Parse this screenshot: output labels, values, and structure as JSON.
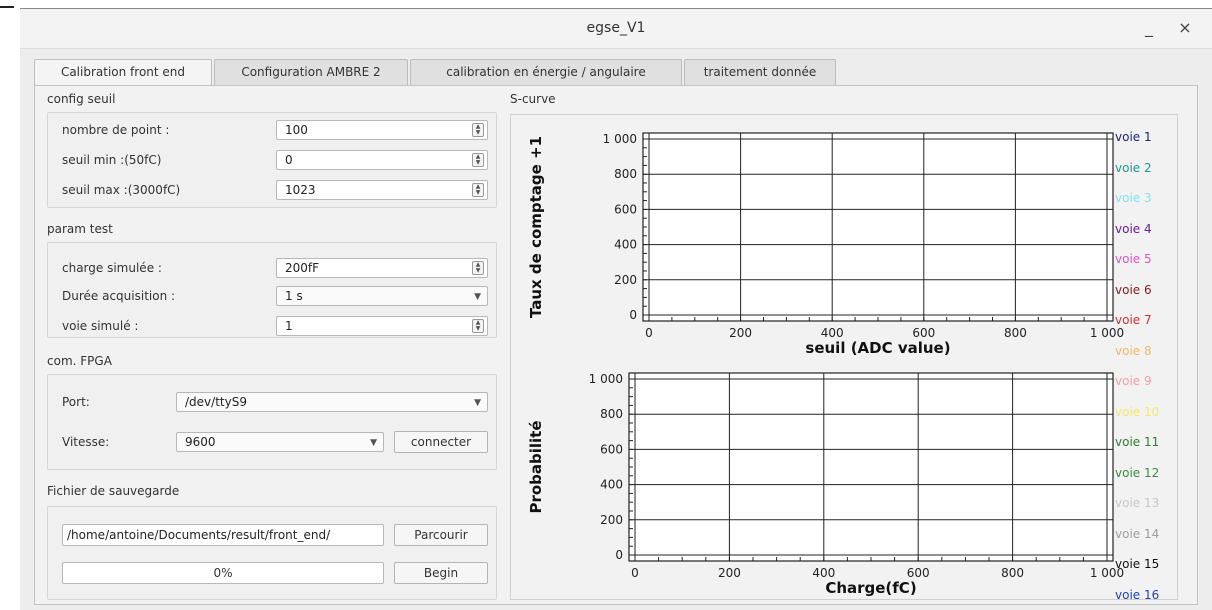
{
  "window": {
    "title": "egse_V1",
    "minimize": "_",
    "close": "×"
  },
  "tabs": [
    {
      "label": "Calibration front end",
      "active": true
    },
    {
      "label": "Configuration AMBRE 2",
      "active": false
    },
    {
      "label": "calibration en énergie / angulaire",
      "active": false
    },
    {
      "label": "traitement donnée",
      "active": false
    }
  ],
  "config_seuil": {
    "title": "config seuil",
    "nombre_label": "nombre de point :",
    "nombre_value": "100",
    "seuil_min_label": "seuil min :(50fC)",
    "seuil_min_value": "0",
    "seuil_max_label": "seuil max :(3000fC)",
    "seuil_max_value": "1023"
  },
  "param_test": {
    "title": "param test",
    "charge_label": "charge simulée :",
    "charge_value": "200fF",
    "duree_label": "Durée acquisition :",
    "duree_value": "1 s",
    "voie_label": "voie simulé :",
    "voie_value": "1"
  },
  "com_fpga": {
    "title": "com. FPGA",
    "port_label": "Port:",
    "port_value": "/dev/ttyS9",
    "vitesse_label": "Vitesse:",
    "vitesse_value": "9600",
    "connect_label": "connecter"
  },
  "fichier": {
    "title": "Fichier de sauvegarde",
    "path_value": "/home/antoine/Documents/result/front_end/",
    "browse_label": "Parcourir",
    "progress_text": "0%",
    "progress": 0,
    "begin_label": "Begin"
  },
  "plot_title": "S-curve",
  "legend": [
    {
      "label": "voie 1",
      "color": "#1a237e"
    },
    {
      "label": "voie 2",
      "color": "#1a9a8a"
    },
    {
      "label": "voie 3",
      "color": "#7fe3ee"
    },
    {
      "label": "voie 4",
      "color": "#6a1b9a"
    },
    {
      "label": "voie 5",
      "color": "#e050d0"
    },
    {
      "label": "voie 6",
      "color": "#8b1a1a"
    },
    {
      "label": "voie 7",
      "color": "#d32f2f"
    },
    {
      "label": "voie 8",
      "color": "#f0b860"
    },
    {
      "label": "voie 9",
      "color": "#f2a0a0"
    },
    {
      "label": "voie 10",
      "color": "#f8e860"
    },
    {
      "label": "voie 11",
      "color": "#2e7d32"
    },
    {
      "label": "voie 12",
      "color": "#388e3c"
    },
    {
      "label": "voie 13",
      "color": "#c8c8c8"
    },
    {
      "label": "voie 14",
      "color": "#9e9e9e"
    },
    {
      "label": "voie 15",
      "color": "#111111"
    },
    {
      "label": "voie 16",
      "color": "#1e3fbf"
    }
  ],
  "chart_data": [
    {
      "type": "line",
      "xlabel": "seuil (ADC value)",
      "ylabel": "Taux de comptage +1",
      "xlim": [
        0,
        1000
      ],
      "ylim": [
        0,
        1000
      ],
      "x_ticks": [
        "0",
        "200",
        "400",
        "600",
        "800",
        "1 000"
      ],
      "y_ticks": [
        "0",
        "200",
        "400",
        "600",
        "800",
        "1 000"
      ],
      "grid": true,
      "series": []
    },
    {
      "type": "line",
      "xlabel": "Charge(fC)",
      "ylabel": "Probabilité",
      "xlim": [
        0,
        1000
      ],
      "ylim": [
        0,
        1000
      ],
      "x_ticks": [
        "0",
        "200",
        "400",
        "600",
        "800",
        "1 000"
      ],
      "y_ticks": [
        "0",
        "200",
        "400",
        "600",
        "800",
        "1 000"
      ],
      "grid": true,
      "series": []
    }
  ]
}
